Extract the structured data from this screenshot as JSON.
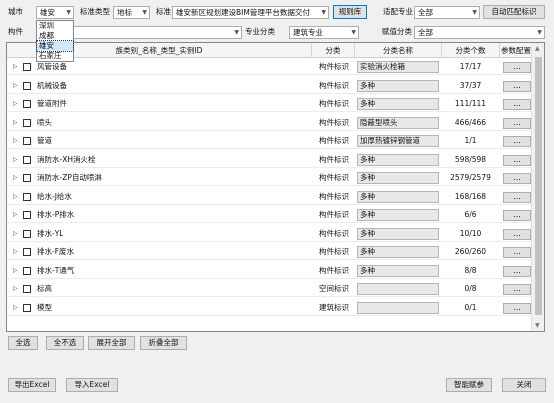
{
  "toolbar": {
    "city_label": "城市",
    "city_value": "雄安",
    "standard_type_label": "标准类型",
    "standard_type_value": "地标",
    "standard_label": "标准",
    "standard_value": "雄安新区规划建设BIM管理平台数据交付",
    "rules_button": "规则库",
    "major_label": "适配专业",
    "major_value": "全部",
    "auto_match_button": "自动匹配标识",
    "component_label": "构件",
    "major_category_label": "专业分类",
    "major_category_value": "建筑专业",
    "assign_category_label": "赋值分类",
    "assign_category_value": "全部"
  },
  "city_dropdown": [
    "深圳",
    "成都",
    "雄安",
    "石家庄"
  ],
  "table": {
    "headers": [
      "族类别_名称_类型_实例ID",
      "分类",
      "分类名称",
      "分类个数",
      "参数配置"
    ],
    "rows": [
      {
        "name": "风管设备",
        "category": "构件标识",
        "category_name": "实验消火栓箱",
        "count": "17/17"
      },
      {
        "name": "机械设备",
        "category": "构件标识",
        "category_name": "多种",
        "count": "37/37"
      },
      {
        "name": "管道附件",
        "category": "构件标识",
        "category_name": "多种",
        "count": "111/111"
      },
      {
        "name": "喷头",
        "category": "构件标识",
        "category_name": "隐蔽型喷头",
        "count": "466/466"
      },
      {
        "name": "管道",
        "category": "构件标识",
        "category_name": "加厚热镀锌钢管道",
        "count": "1/1"
      },
      {
        "name": "消防水-XH消火栓",
        "category": "构件标识",
        "category_name": "多种",
        "count": "598/598"
      },
      {
        "name": "消防水-ZP自动喷淋",
        "category": "构件标识",
        "category_name": "多种",
        "count": "2579/2579"
      },
      {
        "name": "给水-J给水",
        "category": "构件标识",
        "category_name": "多种",
        "count": "168/168"
      },
      {
        "name": "排水-P排水",
        "category": "构件标识",
        "category_name": "多种",
        "count": "6/6"
      },
      {
        "name": "排水-YL",
        "category": "构件标识",
        "category_name": "多种",
        "count": "10/10"
      },
      {
        "name": "排水-F废水",
        "category": "构件标识",
        "category_name": "多种",
        "count": "260/260"
      },
      {
        "name": "排水-T通气",
        "category": "构件标识",
        "category_name": "多种",
        "count": "8/8"
      },
      {
        "name": "标高",
        "category": "空间标识",
        "category_name": "",
        "count": "0/8"
      },
      {
        "name": "模型",
        "category": "建筑标识",
        "category_name": "",
        "count": "0/1"
      }
    ],
    "param_button": "..."
  },
  "bottom": {
    "select_all": "全选",
    "select_none": "全不选",
    "expand_all": "展开全部",
    "collapse_all": "折叠全部",
    "export_excel": "导出Excel",
    "import_excel": "导入Excel",
    "smart_assign": "智能赋参",
    "close": "关闭"
  }
}
